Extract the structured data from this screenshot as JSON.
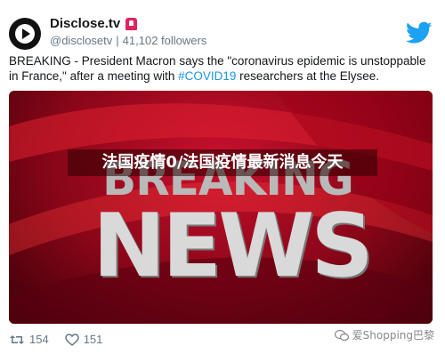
{
  "account": {
    "name": "Disclose.tv",
    "handle": "@disclosetv",
    "separator": "|",
    "followers": "41,102 followers",
    "avatar_icon": "play-icon",
    "badge_icon": "siren-icon"
  },
  "tweet": {
    "text_before": "BREAKING - President Macron says the \"coronavirus epidemic is unstoppable in France,\" after a meeting with ",
    "hashtag": "#COVID19",
    "text_after": " researchers at the Elysee."
  },
  "media": {
    "headline_top": "BREAKING",
    "headline_bottom": "NEWS",
    "overlay_caption": "法国疫情0/法国疫情最新消息今天"
  },
  "actions": {
    "retweets": "154",
    "likes": "151",
    "retweet_icon": "retweet-icon",
    "like_icon": "heart-icon"
  },
  "watermark": {
    "text": "爱Shopping巴黎",
    "icon": "wechat-icon"
  },
  "colors": {
    "hashtag": "#1b95e0",
    "twitter_blue": "#1da1f2",
    "muted": "#657786",
    "media_red": "#c8102e"
  }
}
